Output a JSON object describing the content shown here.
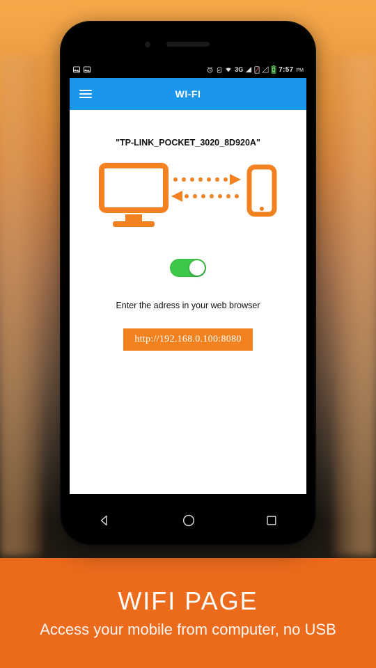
{
  "status_bar": {
    "time": "7:57",
    "time_suffix": "PM",
    "network_label": "3G"
  },
  "app_bar": {
    "title": "WI-FI"
  },
  "content": {
    "network_name": "\"TP-LINK_POCKET_3020_8D920A\"",
    "toggle_on": true,
    "instruction": "Enter the adress in your web browser",
    "url": "http://192.168.0.100:8080"
  },
  "footer": {
    "title": "WIFI PAGE",
    "subtitle": "Access your mobile from computer, no USB"
  },
  "colors": {
    "accent_blue": "#1c96ea",
    "accent_orange": "#f28120",
    "toggle_green": "#3cc94a",
    "footer_orange": "#ec6a1c"
  }
}
